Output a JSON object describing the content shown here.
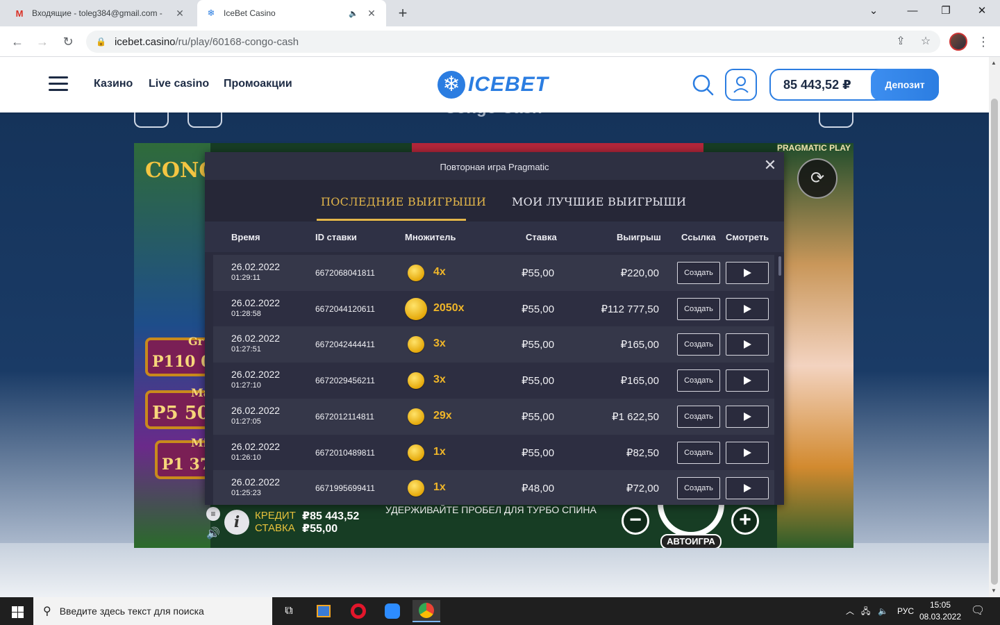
{
  "browser": {
    "tabs": [
      {
        "title": "Входящие - toleg384@gmail.com -",
        "favicon": "gmail-icon"
      },
      {
        "title": "IceBet Casino",
        "favicon": "icebet-icon",
        "active": true
      }
    ],
    "url_host": "icebet.casino",
    "url_path": "/ru/play/60168-congo-cash"
  },
  "site": {
    "nav": [
      "Казино",
      "Live casino",
      "Промоакции"
    ],
    "logo_text": "ICEBET",
    "balance": "85 443,52 ₽",
    "deposit_label": "Депозит",
    "game_title": "Congo Cash"
  },
  "game": {
    "provider_logo": "PRAGMATIC PLAY",
    "left_title": "CONGO CASH",
    "jackpots": [
      {
        "label": "Gr",
        "value": "P110 0"
      },
      {
        "label": "Ma",
        "value": "P5 50"
      },
      {
        "label": "Mi",
        "value": "P1 37"
      }
    ],
    "credit_label": "КРЕДИТ",
    "credit_value": "₽85 443,52",
    "bet_label": "СТАВКА",
    "bet_value": "₽55,00",
    "hint": "УДЕРЖИВАЙТЕ ПРОБЕЛ ДЛЯ ТУРБО СПИНА",
    "autoplay_label": "АВТОИГРА",
    "minus": "−",
    "plus": "+"
  },
  "modal": {
    "title": "Повторная игра Pragmatic",
    "tabs": [
      "ПОСЛЕДНИЕ ВЫИГРЫШИ",
      "МОИ ЛУЧШИЕ ВЫИГРЫШИ"
    ],
    "columns": [
      "Время",
      "ID ставки",
      "Множитель",
      "Ставка",
      "Выигрыш",
      "Ссылка",
      "Смотреть"
    ],
    "create_label": "Создать",
    "rows": [
      {
        "date": "26.02.2022",
        "time": "01:29:11",
        "id": "6672068041811",
        "mult": "4x",
        "bet": "₽55,00",
        "win": "₽220,00"
      },
      {
        "date": "26.02.2022",
        "time": "01:28:58",
        "id": "6672044120611",
        "mult": "2050x",
        "bet": "₽55,00",
        "win": "₽112 777,50",
        "big": true
      },
      {
        "date": "26.02.2022",
        "time": "01:27:51",
        "id": "6672042444411",
        "mult": "3x",
        "bet": "₽55,00",
        "win": "₽165,00"
      },
      {
        "date": "26.02.2022",
        "time": "01:27:10",
        "id": "6672029456211",
        "mult": "3x",
        "bet": "₽55,00",
        "win": "₽165,00"
      },
      {
        "date": "26.02.2022",
        "time": "01:27:05",
        "id": "6672012114811",
        "mult": "29x",
        "bet": "₽55,00",
        "win": "₽1 622,50"
      },
      {
        "date": "26.02.2022",
        "time": "01:26:10",
        "id": "6672010489811",
        "mult": "1x",
        "bet": "₽55,00",
        "win": "₽82,50"
      },
      {
        "date": "26.02.2022",
        "time": "01:25:23",
        "id": "6671995699411",
        "mult": "1x",
        "bet": "₽48,00",
        "win": "₽72,00"
      }
    ]
  },
  "taskbar": {
    "search_placeholder": "Введите здесь текст для поиска",
    "lang": "РУС",
    "time": "15:05",
    "date": "08.03.2022"
  },
  "colors": {
    "accent": "#2b7de1",
    "gold": "#e3b64a",
    "modal_bg": "#2a2b3d"
  }
}
